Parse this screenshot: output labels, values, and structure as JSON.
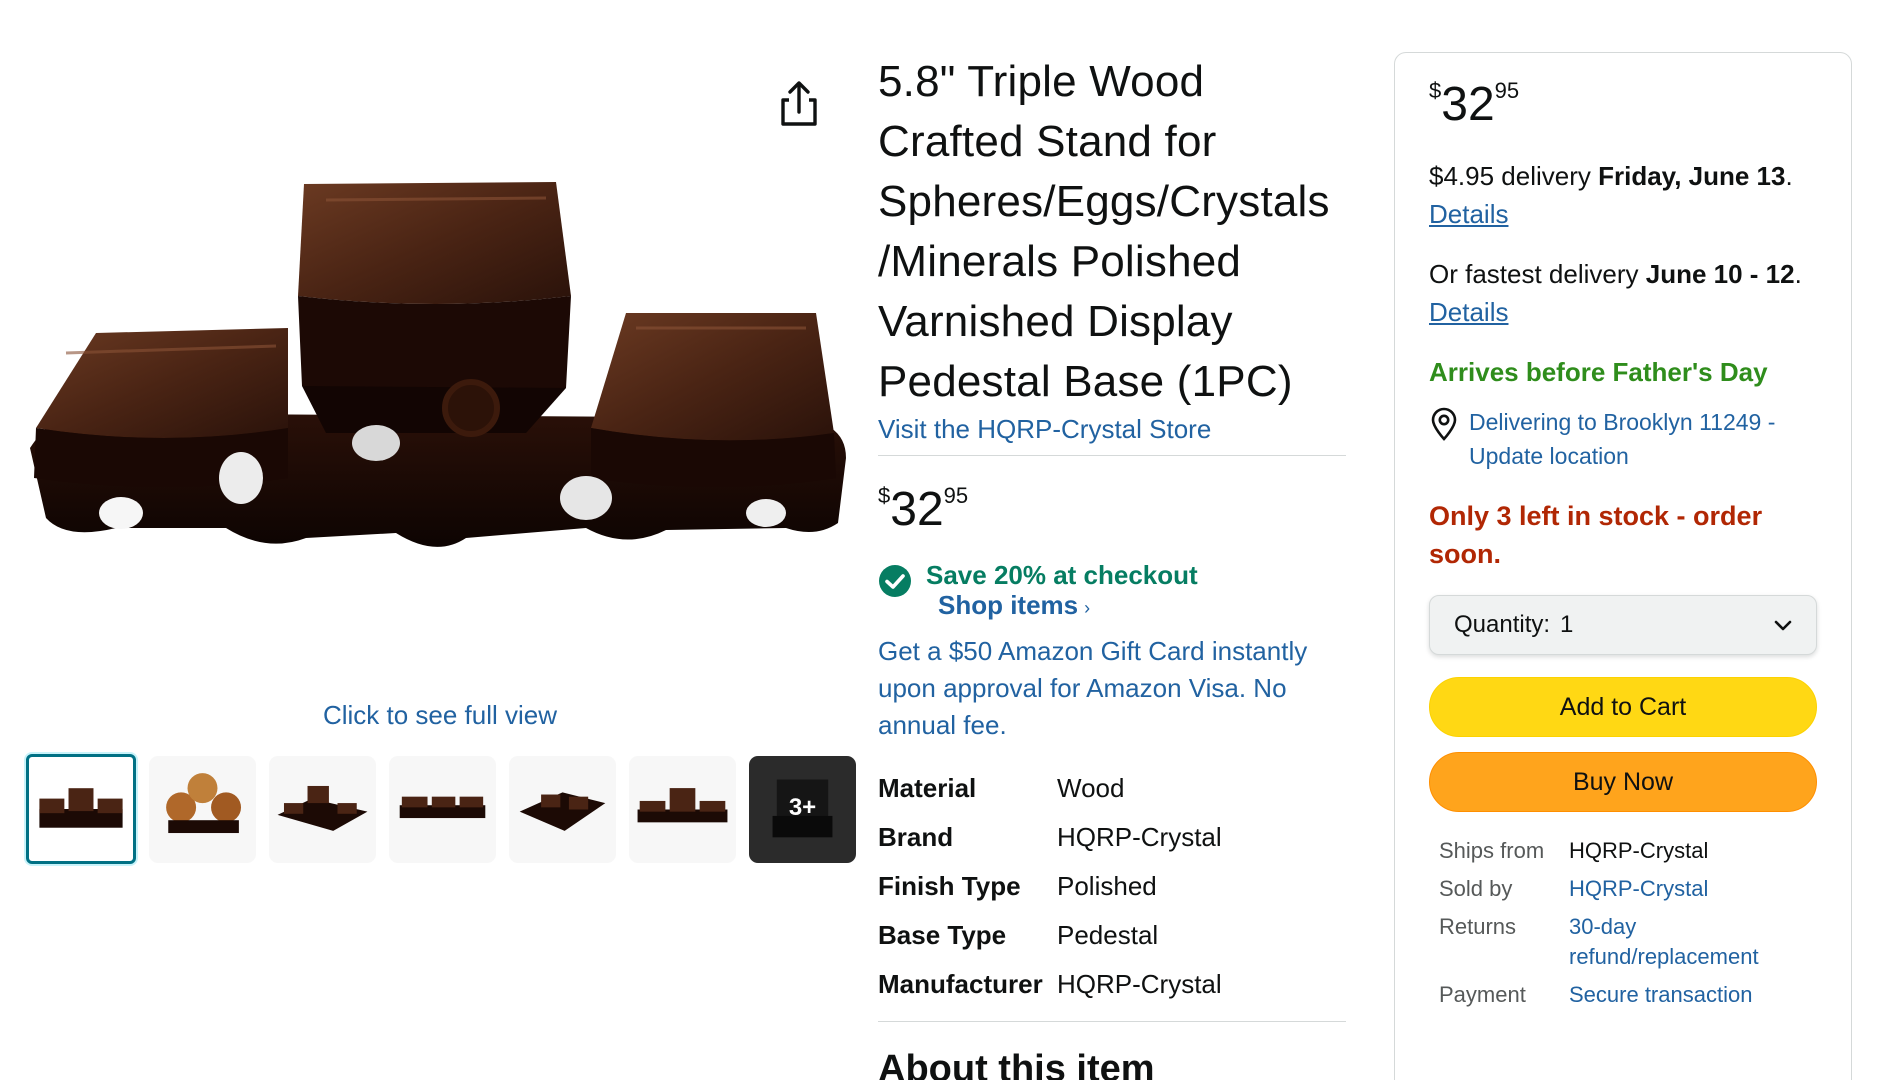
{
  "gallery": {
    "full_view_label": "Click to see full view",
    "more_thumbs_label": "3+",
    "thumbnail_count": 7
  },
  "product": {
    "title": "5.8\" Triple Wood Crafted Stand for Spheres/Eggs/Crystals /Minerals Polished Varnished Display Pedestal Base (1PC)",
    "store_link": "Visit the HQRP-Crystal Store",
    "price": {
      "symbol": "$",
      "whole": "32",
      "fraction": "95"
    },
    "coupon": {
      "text": "Save 20% at checkout",
      "link": "Shop items"
    },
    "gift_card": "Get a $50 Amazon Gift Card instantly upon approval for Amazon Visa. No annual fee.",
    "specs": [
      {
        "key": "Material",
        "value": "Wood"
      },
      {
        "key": "Brand",
        "value": "HQRP-Crystal"
      },
      {
        "key": "Finish Type",
        "value": "Polished"
      },
      {
        "key": "Base Type",
        "value": "Pedestal"
      },
      {
        "key": "Manufacturer",
        "value": "HQRP-Crystal"
      }
    ],
    "about_heading": "About this item"
  },
  "buybox": {
    "price": {
      "symbol": "$",
      "whole": "32",
      "fraction": "95"
    },
    "delivery": {
      "prefix": "$4.95 delivery ",
      "date": "Friday, June 13",
      "suffix": ".",
      "details": "Details"
    },
    "fastest": {
      "prefix": "Or fastest delivery ",
      "date": "June 10 - 12",
      "suffix": ".",
      "details": "Details"
    },
    "fathers_day": "Arrives before Father's Day",
    "location": "Delivering to Brooklyn 11249 - Update location",
    "stock": "Only 3 left in stock - order soon.",
    "quantity": {
      "label": "Quantity:",
      "value": "1"
    },
    "add_to_cart": "Add to Cart",
    "buy_now": "Buy Now",
    "meta": [
      {
        "key": "Ships from",
        "value": "HQRP-Crystal",
        "link": false
      },
      {
        "key": "Sold by",
        "value": "HQRP-Crystal",
        "link": true
      },
      {
        "key": "Returns",
        "value": "30-day refund/replacement",
        "link": true
      },
      {
        "key": "Payment",
        "value": "Secure transaction",
        "link": true
      }
    ]
  },
  "colors": {
    "link": "#2162a1",
    "price_green": "#067d62",
    "fathers_green": "#2f8d1c",
    "stock_red": "#b12704",
    "cart_yellow": "#ffd814",
    "buy_orange": "#ffa41c"
  }
}
